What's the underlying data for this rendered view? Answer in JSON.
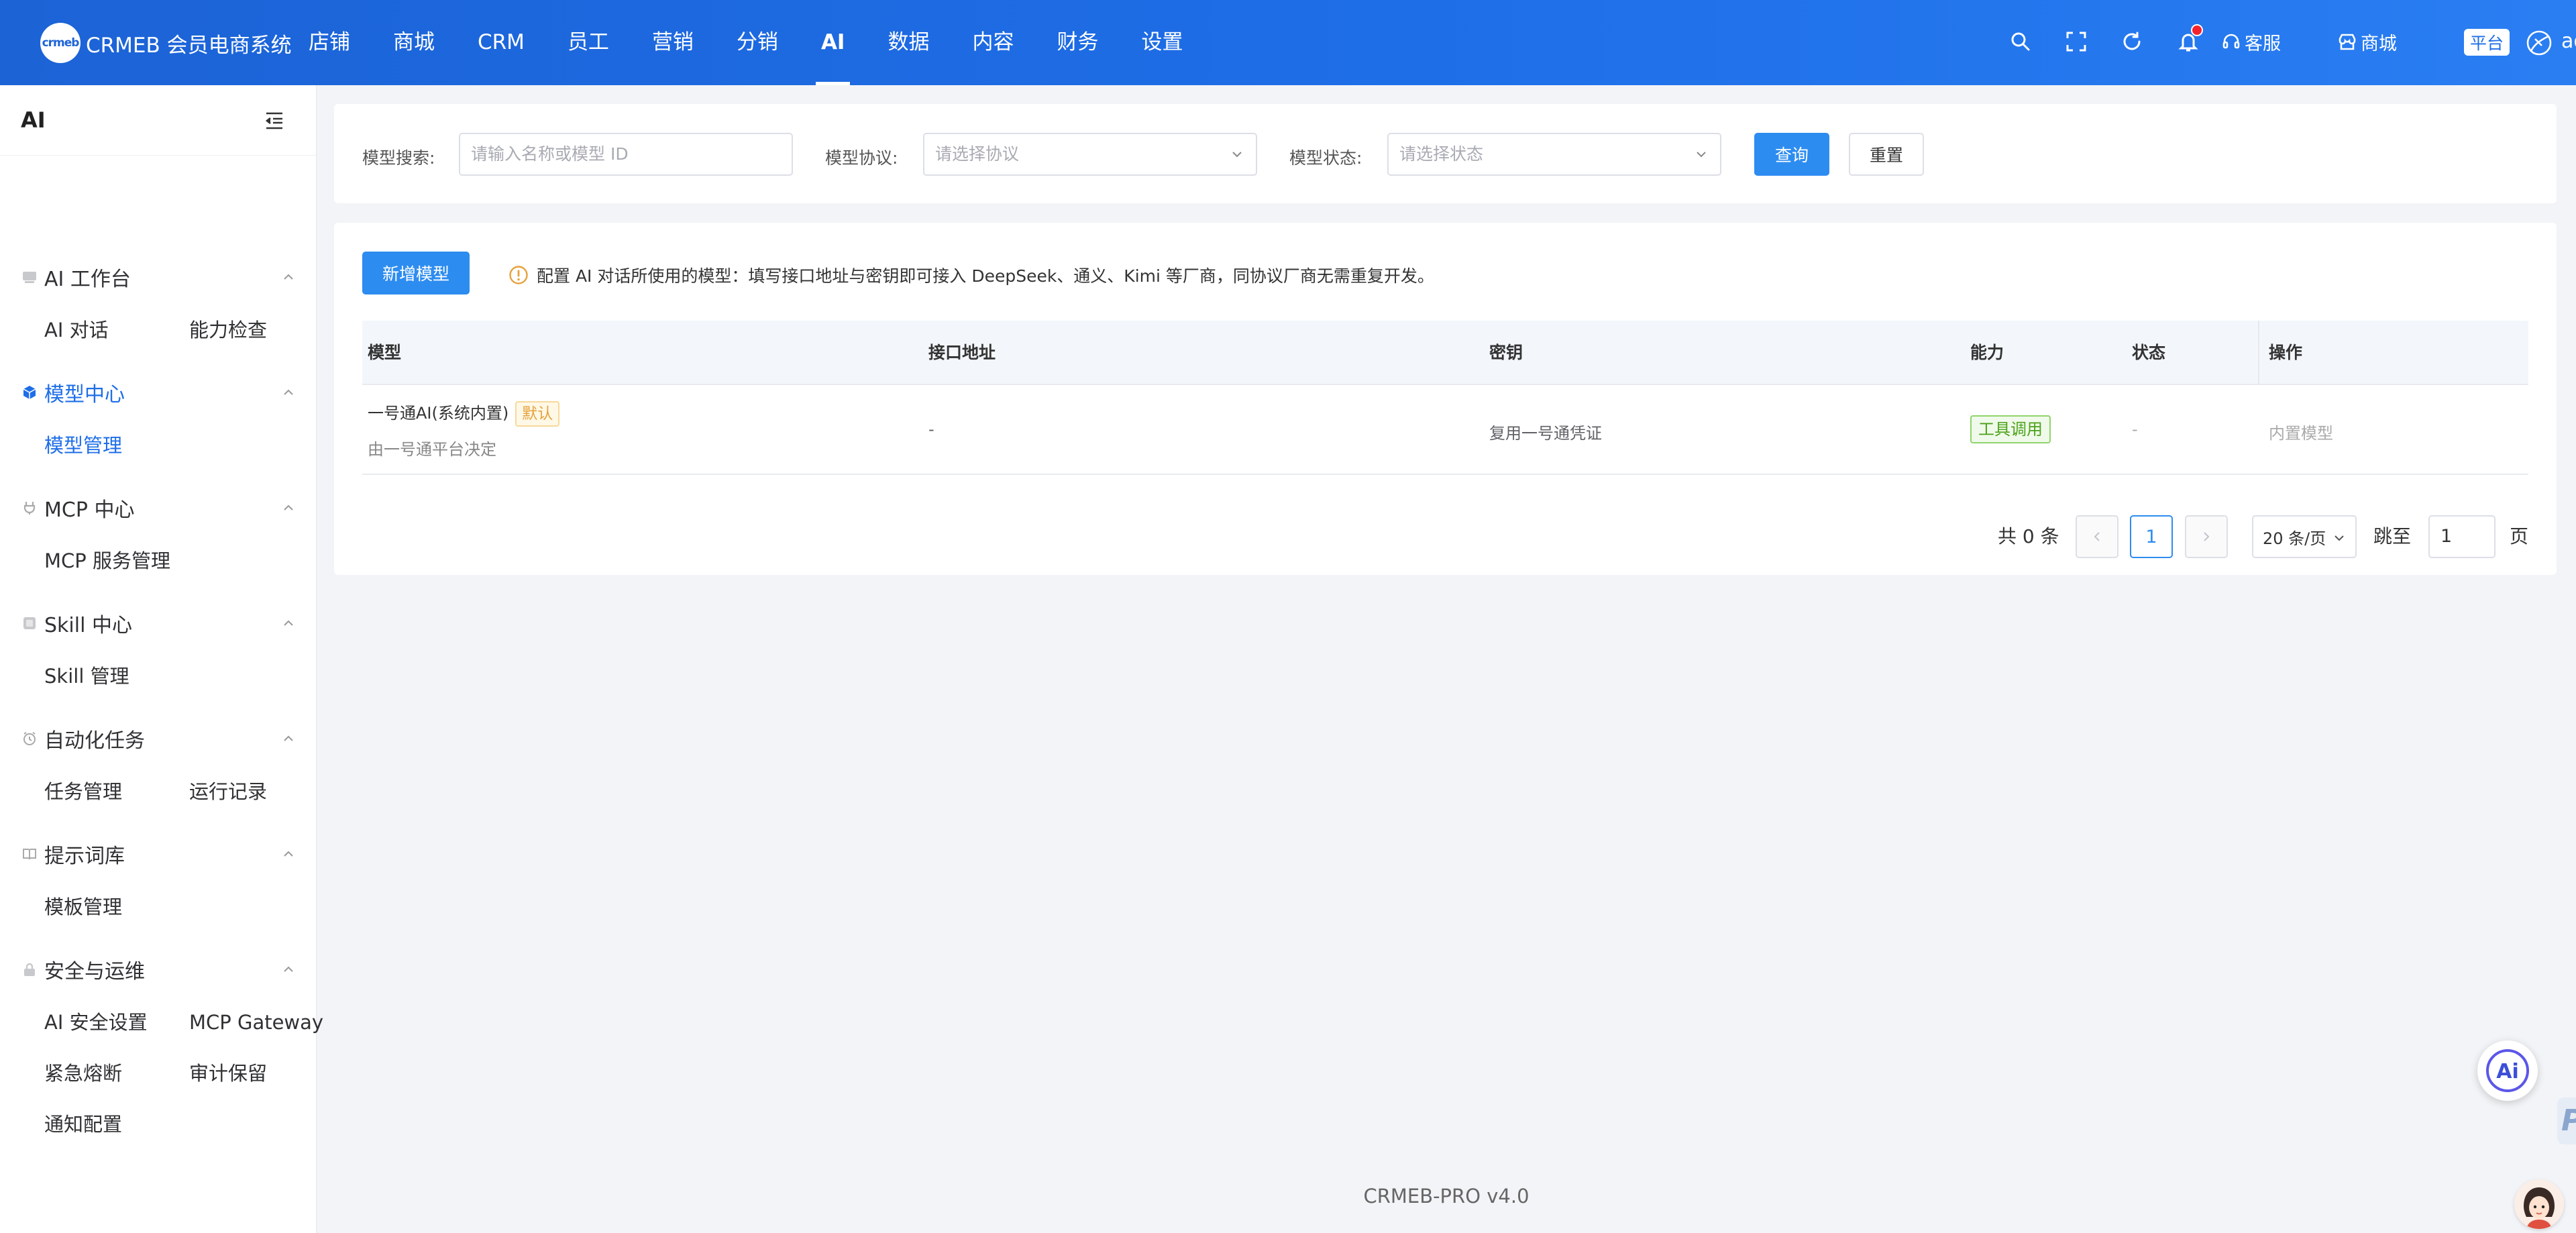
{
  "header": {
    "logo_text": "crmeb",
    "brand": "CRMEB 会员电商系统",
    "nav": [
      "店铺",
      "商城",
      "CRM",
      "员工",
      "营销",
      "分销",
      "AI",
      "数据",
      "内容",
      "财务",
      "设置"
    ],
    "active_nav": "AI",
    "service_label": "客服",
    "mall_label": "商城",
    "platform_label": "平台",
    "username": "admin"
  },
  "sidebar": {
    "title": "AI",
    "groups": [
      {
        "label": "AI 工作台",
        "icon": "workbench-icon",
        "items": [
          "AI 对话",
          "能力检查"
        ]
      },
      {
        "label": "模型中心",
        "icon": "cube-icon",
        "items": [
          "模型管理"
        ]
      },
      {
        "label": "MCP 中心",
        "icon": "plug-icon",
        "items": [
          "MCP 服务管理"
        ]
      },
      {
        "label": "Skill 中心",
        "icon": "skill-icon",
        "items": [
          "Skill 管理"
        ]
      },
      {
        "label": "自动化任务",
        "icon": "alarm-clock-icon",
        "items": [
          "任务管理",
          "运行记录"
        ]
      },
      {
        "label": "提示词库",
        "icon": "book-icon",
        "items": [
          "模板管理"
        ]
      },
      {
        "label": "安全与运维",
        "icon": "lock-icon",
        "items": [
          "AI 安全设置",
          "MCP Gateway",
          "紧急熔断",
          "审计保留",
          "通知配置"
        ]
      }
    ],
    "active_group": "模型中心",
    "active_item": "模型管理"
  },
  "search": {
    "keyword_label": "模型搜索:",
    "keyword_placeholder": "请输入名称或模型 ID",
    "protocol_label": "模型协议:",
    "protocol_placeholder": "请选择协议",
    "status_label": "模型状态:",
    "status_placeholder": "请选择状态",
    "query_button": "查询",
    "reset_button": "重置"
  },
  "main": {
    "add_button": "新增模型",
    "notice": "配置 AI 对话所使用的模型：填写接口地址与密钥即可接入 DeepSeek、通义、Kimi 等厂商，同协议厂商无需重复开发。",
    "columns": [
      "模型",
      "接口地址",
      "密钥",
      "能力",
      "状态",
      "操作"
    ],
    "rows": [
      {
        "model_name": "一号通AI(系统内置)",
        "default_tag": "默认",
        "model_desc": "由一号通平台决定",
        "endpoint": "-",
        "secret": "复用一号通凭证",
        "ability": "工具调用",
        "status": "-",
        "action": "内置模型"
      }
    ]
  },
  "pagination": {
    "total_text": "共 0 条",
    "current_page": "1",
    "page_size": "20 条/页",
    "jump_label": "跳至",
    "jump_value": "1",
    "page_suffix": "页"
  },
  "footer": {
    "version": "CRMEB-PRO v4.0"
  },
  "floating": {
    "ai_label": "Ai",
    "side_tab_letter": "P"
  },
  "colors": {
    "header_start": "#1c63d6",
    "header_end": "#2a7ef2",
    "primary": "#2d8cf0",
    "active_menu": "#1e6ee8",
    "tag_default": "#e6a23c",
    "tag_ability": "#4ba21b"
  }
}
